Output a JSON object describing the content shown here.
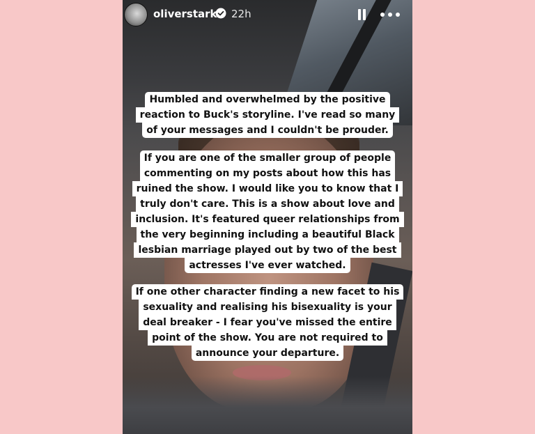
{
  "story": {
    "username": "oliverstarkk",
    "verified_icon": "verified-badge-icon",
    "posted_ago": "22h",
    "controls": {
      "pause_icon": "pause-icon",
      "more_icon": "more-options-icon"
    }
  },
  "captions": [
    {
      "lines": [
        "Humbled and overwhelmed by the positive",
        "reaction to Buck's storyline. I've read so many",
        "of your messages and I couldn't be prouder."
      ]
    },
    {
      "lines": [
        "If you are one of the smaller group of people",
        "commenting on my posts about how this has",
        "ruined the show. I would like you to know that I",
        "truly don't care. This is a show about love and",
        "inclusion. It's featured queer relationships from",
        "the very beginning including a beautiful Black",
        "lesbian marriage played out by two of the best",
        "actresses I've ever watched."
      ]
    },
    {
      "lines": [
        "If one other character finding a new facet to his",
        "sexuality and realising his bisexuality  is your",
        "deal breaker  - I fear you've missed the entire",
        "point of the show. You are not required to",
        "announce your departure."
      ]
    }
  ],
  "colors": {
    "page_background": "#f8c8c8",
    "caption_background": "#ffffff",
    "caption_text": "#111111"
  }
}
